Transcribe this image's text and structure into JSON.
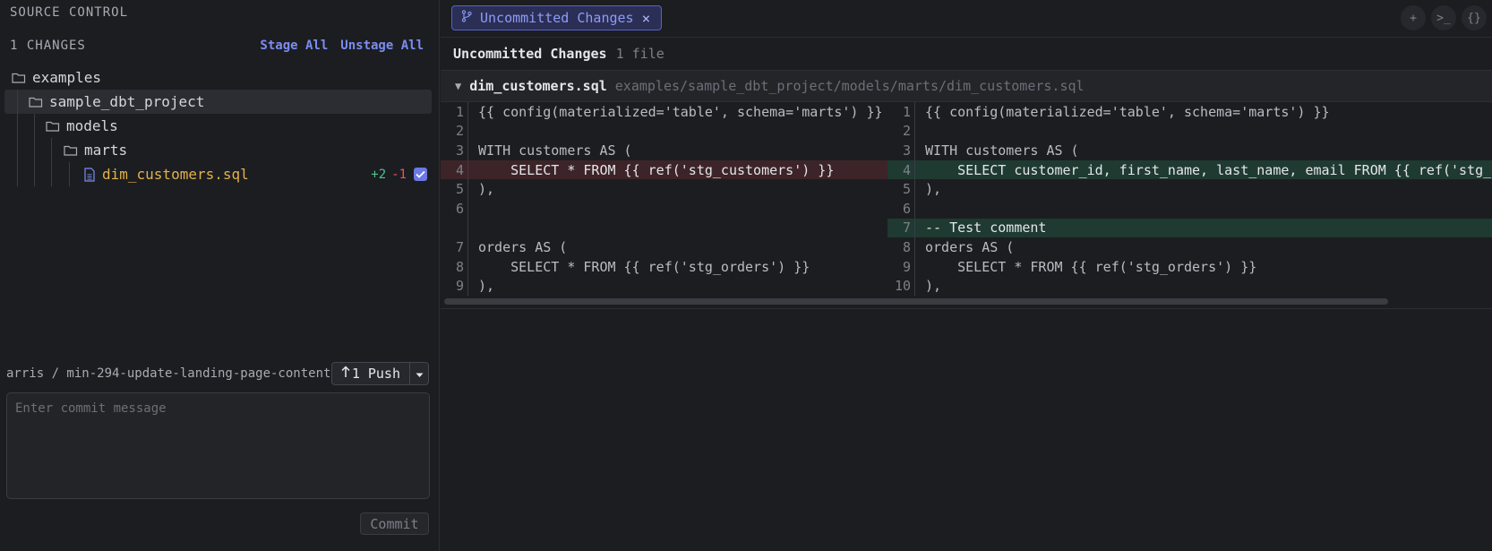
{
  "sidebar": {
    "title": "SOURCE CONTROL",
    "changes_count": "1 CHANGES",
    "stage_all": "Stage All",
    "unstage_all": "Unstage All",
    "tree": [
      {
        "label": "examples",
        "type": "folder",
        "depth": 0
      },
      {
        "label": "sample_dbt_project",
        "type": "folder",
        "depth": 1,
        "selected": true
      },
      {
        "label": "models",
        "type": "folder",
        "depth": 2
      },
      {
        "label": "marts",
        "type": "folder",
        "depth": 3
      },
      {
        "label": "dim_customers.sql",
        "type": "file",
        "depth": 4,
        "additions": "+2",
        "deletions": "-1",
        "checked": true
      }
    ],
    "branch": "arris / min-294-update-landing-page-content",
    "push_label": "1 Push",
    "commit_placeholder": "Enter commit message",
    "commit_button": "Commit"
  },
  "main": {
    "tab_label": "Uncommitted Changes",
    "summary_title": "Uncommitted Changes",
    "summary_count": "1 file",
    "file": {
      "name": "dim_customers.sql",
      "path": "examples/sample_dbt_project/models/marts/dim_customers.sql"
    },
    "left_lines": [
      {
        "n": "1",
        "text": "{{ config(materialized='table', schema='marts') }}",
        "kind": "ctx"
      },
      {
        "n": "2",
        "text": "",
        "kind": "ctx"
      },
      {
        "n": "3",
        "text": "WITH customers AS (",
        "kind": "ctx"
      },
      {
        "n": "4",
        "text": "    SELECT * FROM {{ ref('stg_customers') }}",
        "kind": "del"
      },
      {
        "n": "5",
        "text": "),",
        "kind": "ctx"
      },
      {
        "n": "6",
        "text": "",
        "kind": "ctx"
      },
      {
        "n": "",
        "text": "",
        "kind": "pad"
      },
      {
        "n": "7",
        "text": "orders AS (",
        "kind": "ctx"
      },
      {
        "n": "8",
        "text": "    SELECT * FROM {{ ref('stg_orders') }}",
        "kind": "ctx"
      },
      {
        "n": "9",
        "text": "),",
        "kind": "ctx"
      }
    ],
    "right_lines": [
      {
        "n": "1",
        "text": "{{ config(materialized='table', schema='marts') }}",
        "kind": "ctx"
      },
      {
        "n": "2",
        "text": "",
        "kind": "ctx"
      },
      {
        "n": "3",
        "text": "WITH customers AS (",
        "kind": "ctx"
      },
      {
        "n": "4",
        "text": "    SELECT customer_id, first_name, last_name, email FROM {{ ref('stg_cu",
        "kind": "add"
      },
      {
        "n": "5",
        "text": "),",
        "kind": "ctx"
      },
      {
        "n": "6",
        "text": "",
        "kind": "ctx"
      },
      {
        "n": "7",
        "text": "-- Test comment",
        "kind": "add"
      },
      {
        "n": "8",
        "text": "orders AS (",
        "kind": "ctx"
      },
      {
        "n": "9",
        "text": "    SELECT * FROM {{ ref('stg_orders') }}",
        "kind": "ctx"
      },
      {
        "n": "10",
        "text": "),",
        "kind": "ctx"
      }
    ]
  },
  "colors": {
    "accent": "#7b8cf0",
    "added": "#4cc38a",
    "deleted": "#e5545f",
    "file_modified": "#e2b24a"
  },
  "icons": [
    "folder-icon",
    "file-icon",
    "git-branch-icon",
    "close-icon",
    "plus-icon",
    "terminal-icon",
    "braces-icon",
    "chevron-down-icon",
    "arrow-up-icon",
    "check-icon"
  ]
}
